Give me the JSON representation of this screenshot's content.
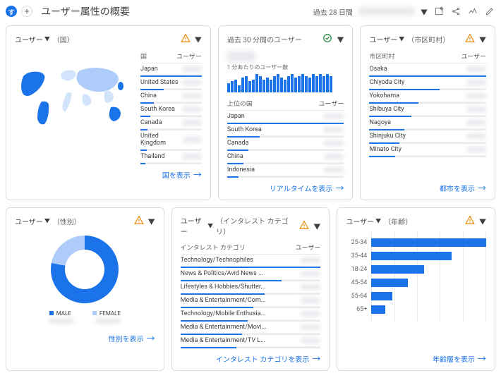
{
  "header": {
    "avatar_letter": "す",
    "title": "ユーザー属性の概要",
    "date_label": "過去 28 日間",
    "date_range_placeholder": "redacted range"
  },
  "metric_label": "ユーザー",
  "cards": {
    "country": {
      "dimension": "（国）",
      "col_dim": "国",
      "col_val": "ユーザー",
      "rows": [
        "Japan",
        "United States",
        "China",
        "South Korea",
        "Canada",
        "United Kingdom",
        "Thailand"
      ],
      "bars": [
        100,
        38,
        22,
        16,
        12,
        10,
        8
      ],
      "link": "国を表示"
    },
    "realtime": {
      "title": "過去 30 分間のユーザー",
      "permin": "1 分あたりのユーザー数",
      "top_label": "上位の国",
      "col_val": "ユーザー",
      "rows": [
        "Japan",
        "South Korea",
        "Canada",
        "China",
        "Indonesia"
      ],
      "bars": [
        100,
        28,
        18,
        14,
        10
      ],
      "link": "リアルタイムを表示"
    },
    "city": {
      "dimension": "（市区町村）",
      "col_dim": "市区町村",
      "col_val": "ユーザー",
      "rows": [
        "Osaka",
        "Chiyoda City",
        "Yokohama",
        "Shibuya City",
        "Nagoya",
        "Shinjuku City",
        "Minato City"
      ],
      "bars": [
        100,
        60,
        42,
        36,
        30,
        26,
        22
      ],
      "link": "都市を表示"
    },
    "gender": {
      "dimension": "（性別）",
      "legend": {
        "male": "MALE",
        "female": "FEMALE"
      },
      "link": "性別を表示"
    },
    "interest": {
      "dimension": "（インタレスト カテゴリ）",
      "col_dim": "インタレスト カテゴリ",
      "col_val": "ユーザー",
      "rows": [
        "Technology/Technophiles",
        "News & Politics/Avid News ...",
        "Lifestyles & Hobbies/Shutter...",
        "Media & Entertainment/Com...",
        "Technology/Mobile Enthusia...",
        "Media & Entertainment/Movi...",
        "Media & Entertainment/TV L..."
      ],
      "bars": [
        100,
        72,
        60,
        52,
        48,
        44,
        40
      ],
      "link": "インタレスト カテゴリを表示"
    },
    "age": {
      "dimension": "（年齢）",
      "link": "年齢層を表示"
    }
  },
  "chart_data": [
    {
      "type": "bar",
      "title": "1 分あたりのユーザー数",
      "categories_count": 30,
      "values": [
        10,
        12,
        14,
        8,
        16,
        18,
        12,
        14,
        20,
        18,
        14,
        16,
        14,
        18,
        20,
        16,
        14,
        18,
        20,
        16,
        18,
        20,
        18,
        16,
        20,
        18,
        20,
        18,
        20,
        18
      ]
    },
    {
      "type": "pie",
      "title": "性別",
      "series": [
        {
          "name": "MALE",
          "value": 78,
          "color": "#1a73e8"
        },
        {
          "name": "FEMALE",
          "value": 22,
          "color": "#aecbfa"
        }
      ]
    },
    {
      "type": "bar",
      "orientation": "horizontal",
      "title": "年齢",
      "categories": [
        "25-34",
        "35-44",
        "18-24",
        "45-54",
        "55-64",
        "65+"
      ],
      "values": [
        100,
        70,
        46,
        32,
        18,
        12
      ]
    }
  ]
}
